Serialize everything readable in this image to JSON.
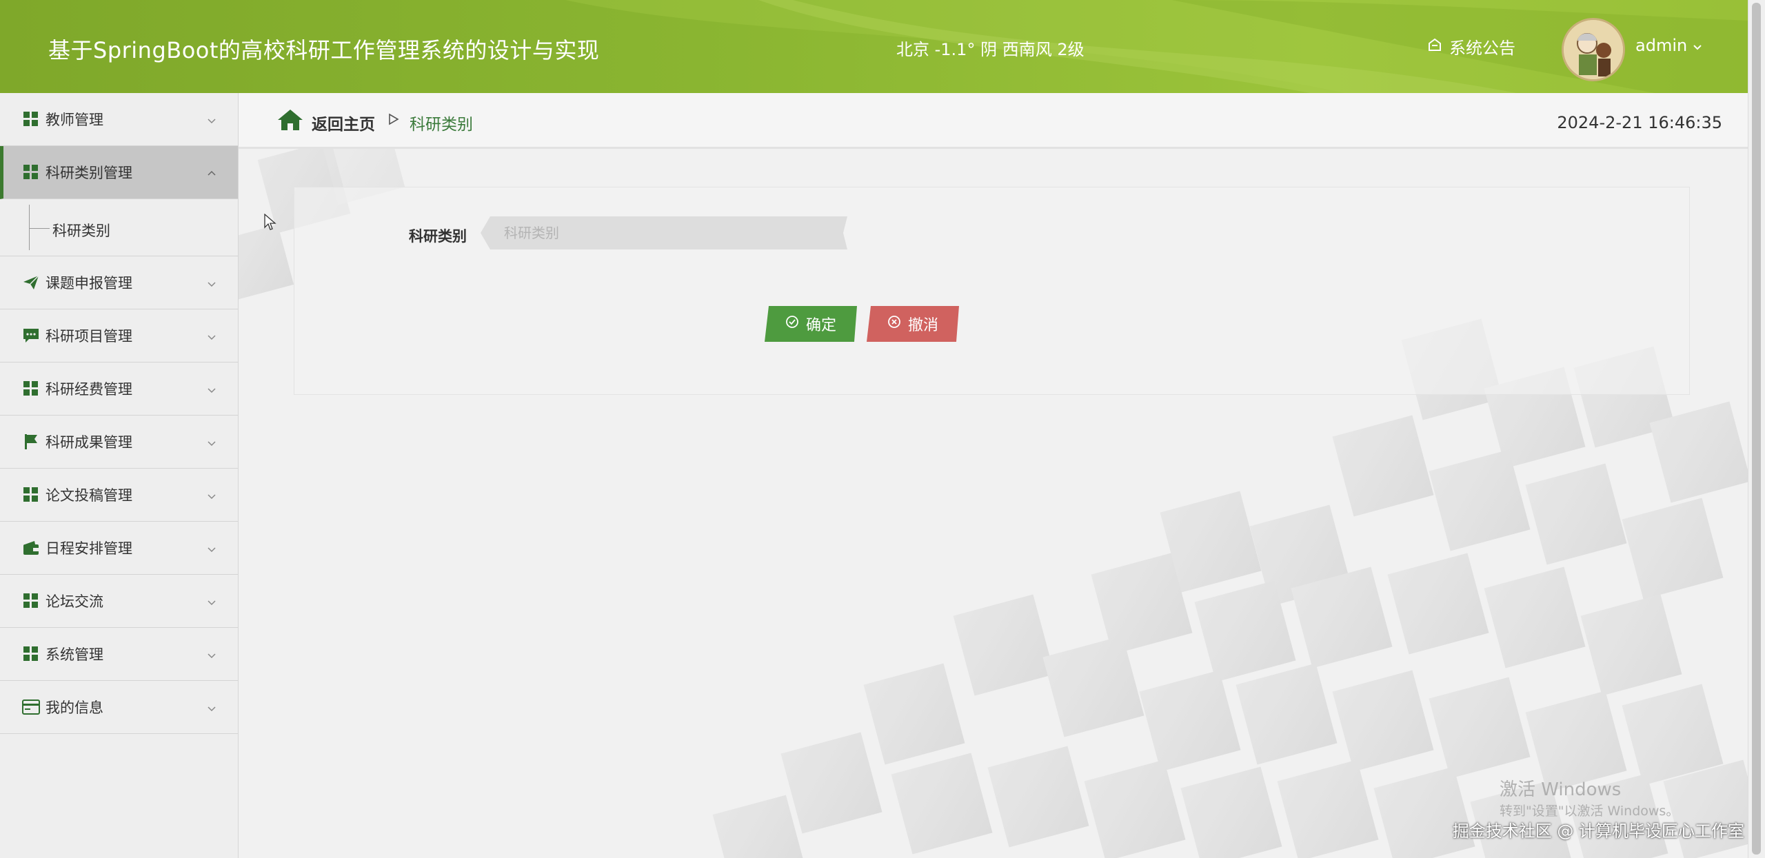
{
  "app": {
    "title": "基于SpringBoot的高校科研工作管理系统的设计与实现",
    "weather": "北京  -1.1°  阴  西南风  2级",
    "notice_label": "系统公告",
    "user_name": "admin"
  },
  "colors": {
    "header": "#8ab531",
    "accent_green": "#3c7a2f",
    "ok_button": "#4e9b3f",
    "cancel_button": "#d0625f"
  },
  "sidebar": {
    "items": [
      {
        "label": "教师管理",
        "icon": "grid-icon"
      },
      {
        "label": "科研类别管理",
        "icon": "grid-icon",
        "active": true
      },
      {
        "label": "课题申报管理",
        "icon": "paper-plane-icon"
      },
      {
        "label": "科研项目管理",
        "icon": "chat-icon"
      },
      {
        "label": "科研经费管理",
        "icon": "grid-icon"
      },
      {
        "label": "科研成果管理",
        "icon": "flag-icon"
      },
      {
        "label": "论文投稿管理",
        "icon": "grid-icon"
      },
      {
        "label": "日程安排管理",
        "icon": "wallet-icon"
      },
      {
        "label": "论坛交流",
        "icon": "grid-icon"
      },
      {
        "label": "系统管理",
        "icon": "grid-icon"
      },
      {
        "label": "我的信息",
        "icon": "card-icon"
      }
    ],
    "submenu": {
      "label": "科研类别"
    }
  },
  "breadcrumb": {
    "home": "返回主页",
    "current": "科研类别"
  },
  "datetime": "2024-2-21 16:46:35",
  "form": {
    "label": "科研类别",
    "placeholder": "科研类别",
    "value": "",
    "ok_label": "确定",
    "cancel_label": "撤消"
  },
  "watermarks": {
    "windows_title": "激活 Windows",
    "windows_sub": "转到\"设置\"以激活 Windows。",
    "site": "掘金技术社区 @ 计算机毕设匠心工作室"
  }
}
